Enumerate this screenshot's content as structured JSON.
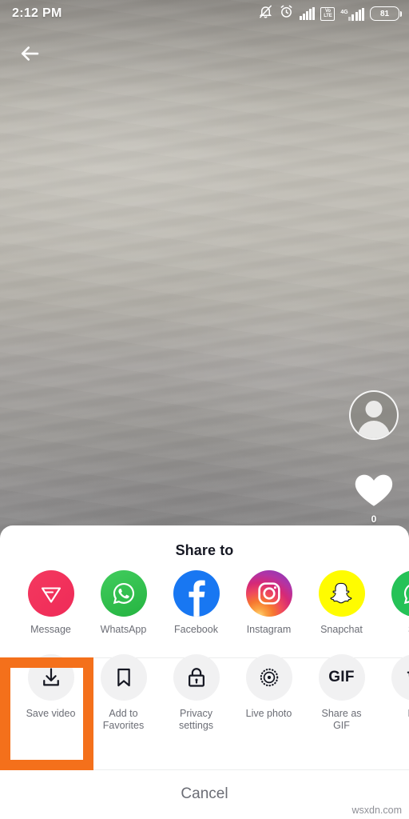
{
  "status_bar": {
    "time": "2:12 PM",
    "battery_percent": "81",
    "network_label": "4G",
    "volte_top": "Vo",
    "volte_bottom": "LTE",
    "icons": [
      "silent-bell-icon",
      "alarm-icon",
      "signal-icon",
      "volte-icon",
      "signal-4g-icon",
      "battery-icon"
    ]
  },
  "video": {
    "back_icon": "back-arrow-icon",
    "avatar_icon": "avatar-placeholder-icon",
    "like_icon": "heart-icon",
    "like_count": "0"
  },
  "sheet": {
    "title": "Share to",
    "apps": [
      {
        "label": "Message",
        "icon": "tiktok-message-icon",
        "color": "#F2335B"
      },
      {
        "label": "WhatsApp",
        "icon": "whatsapp-icon",
        "color": "#2BBA4A"
      },
      {
        "label": "Facebook",
        "icon": "facebook-icon",
        "color": "#1877F2"
      },
      {
        "label": "Instagram",
        "icon": "instagram-icon",
        "color": "#D62976"
      },
      {
        "label": "Snapchat",
        "icon": "snapchat-icon",
        "color": "#FFFC00"
      },
      {
        "label": "Sh",
        "icon": "whatsapp-status-icon",
        "color": "#25C257"
      }
    ],
    "actions": [
      {
        "label": "Save video",
        "icon": "download-icon"
      },
      {
        "label": "Add to\nFavorites",
        "icon": "bookmark-icon"
      },
      {
        "label": "Privacy\nsettings",
        "icon": "lock-icon"
      },
      {
        "label": "Live photo",
        "icon": "live-photo-icon"
      },
      {
        "label": "Share as\nGIF",
        "icon": "gif-icon",
        "glyph": "GIF"
      },
      {
        "label": "De",
        "icon": "trash-icon"
      }
    ],
    "cancel_label": "Cancel"
  },
  "highlight": {
    "target": "Save video",
    "color": "#F4701B"
  },
  "watermark": {
    "text": "wsxdn.com"
  }
}
